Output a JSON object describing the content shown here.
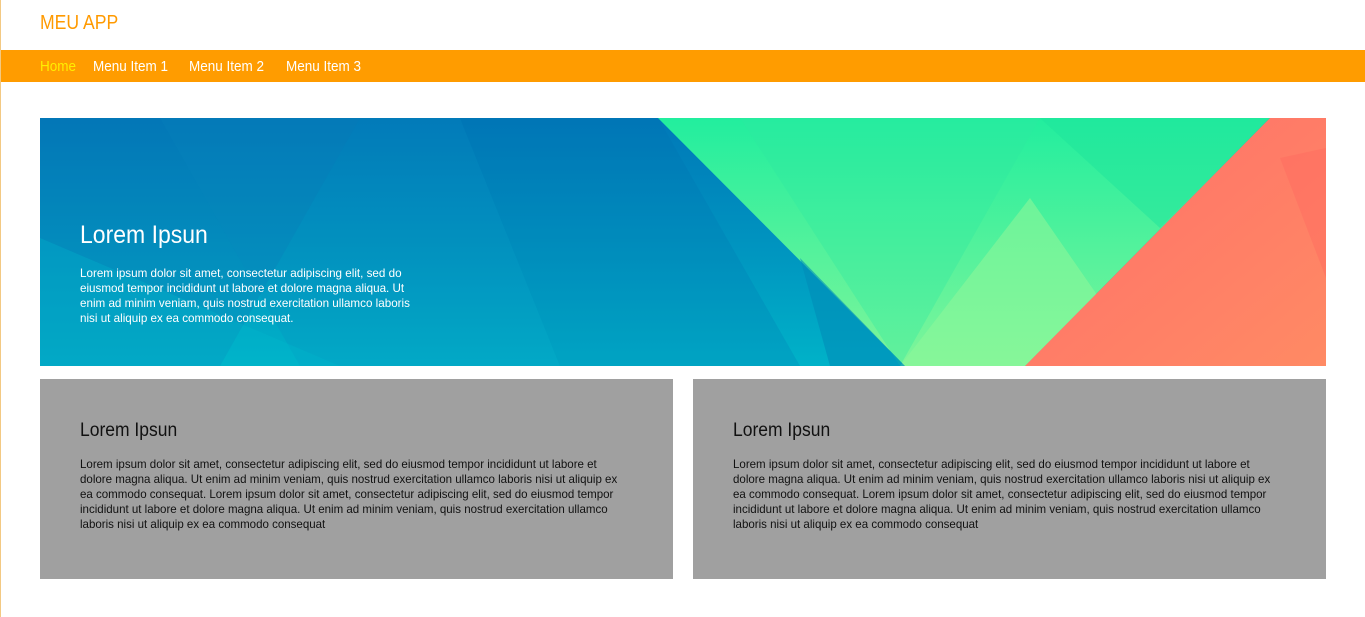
{
  "app": {
    "title": "MEU APP"
  },
  "nav": {
    "items": [
      {
        "label": "Home",
        "active": true
      },
      {
        "label": "Menu Item 1",
        "active": false
      },
      {
        "label": "Menu Item 2",
        "active": false
      },
      {
        "label": "Menu Item 3",
        "active": false
      }
    ]
  },
  "hero": {
    "title": "Lorem Ipsun",
    "text": "Lorem ipsum dolor sit amet, consectetur adipiscing elit, sed do eiusmod tempor incididunt ut labore et dolore magna aliqua. Ut enim ad minim veniam, quis nostrud exercitation ullamco laboris nisi ut aliquip ex ea commodo consequat."
  },
  "cards": [
    {
      "title": "Lorem Ipsun",
      "text": "Lorem ipsum dolor sit amet, consectetur adipiscing elit, sed do eiusmod tempor incididunt ut labore et dolore magna aliqua. Ut enim ad minim veniam, quis nostrud exercitation ullamco laboris nisi ut aliquip ex ea commodo consequat. Lorem ipsum dolor sit amet, consectetur adipiscing elit, sed do eiusmod tempor incididunt ut labore et dolore magna aliqua. Ut enim ad minim veniam, quis nostrud exercitation ullamco laboris nisi ut aliquip ex ea commodo consequat"
    },
    {
      "title": "Lorem Ipsun",
      "text": "Lorem ipsum dolor sit amet, consectetur adipiscing elit, sed do eiusmod tempor incididunt ut labore et dolore magna aliqua. Ut enim ad minim veniam, quis nostrud exercitation ullamco laboris nisi ut aliquip ex ea commodo consequat. Lorem ipsum dolor sit amet, consectetur adipiscing elit, sed do eiusmod tempor incididunt ut labore et dolore magna aliqua. Ut enim ad minim veniam, quis nostrud exercitation ullamco laboris nisi ut aliquip ex ea commodo consequat"
    }
  ],
  "colors": {
    "brand": "#ff9c00",
    "nav_active": "#ffee00",
    "card_bg": "#a0a0a0",
    "hero_blue": "#0088bc",
    "hero_green": "#3ee89a",
    "hero_coral": "#ff7a66"
  }
}
